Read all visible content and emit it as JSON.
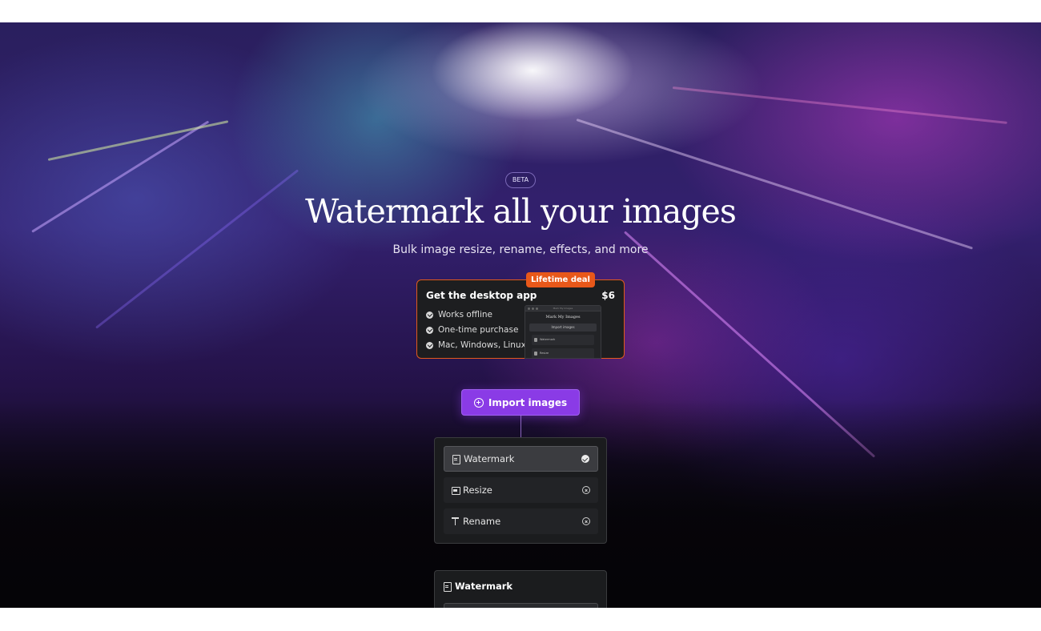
{
  "badge": "BETA",
  "hero": {
    "title": "Watermark all your images",
    "subtitle": "Bulk image resize, rename, effects, and more"
  },
  "deal": {
    "badge": "Lifetime deal",
    "title": "Get the desktop app",
    "price": "$6",
    "features": [
      "Works offline",
      "One-time purchase",
      "Mac, Windows, Linux"
    ],
    "preview": {
      "window_title": "Mark My Images",
      "title": "Mark My Images",
      "button": "Import images",
      "rows": [
        "Watermark",
        "Resize"
      ]
    }
  },
  "import_button": {
    "label": "Import images",
    "icon": "plus-circle-icon"
  },
  "operations": [
    {
      "label": "Watermark",
      "icon": "document-icon",
      "status": "selected-check-icon",
      "active": true
    },
    {
      "label": "Resize",
      "icon": "image-icon",
      "status": "remove-icon",
      "active": false
    },
    {
      "label": "Rename",
      "icon": "text-icon",
      "status": "remove-icon",
      "active": false
    }
  ],
  "watermark_panel": {
    "title": "Watermark",
    "icon": "document-icon"
  },
  "colors": {
    "accent": "#8a3be6",
    "deal_border": "#e25a1c",
    "deal_badge": "#e8581a",
    "panel_bg": "#1b1c1e"
  }
}
